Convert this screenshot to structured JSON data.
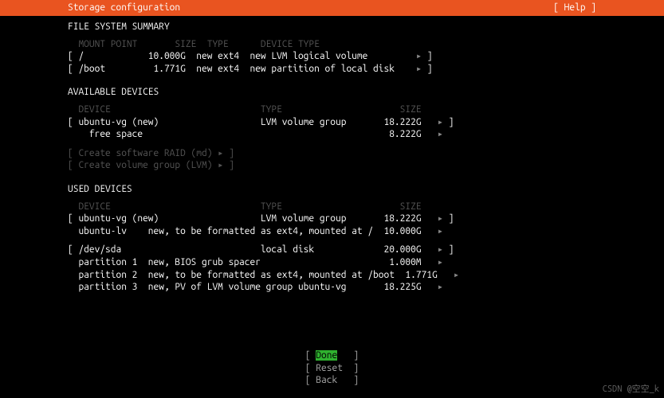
{
  "header": {
    "title": "Storage configuration",
    "help": "[ Help ]"
  },
  "fs_summary": {
    "title": "FILE SYSTEM SUMMARY",
    "cols": {
      "mount": "MOUNT POINT",
      "size": "SIZE",
      "type": "TYPE",
      "dtype": "DEVICE TYPE"
    },
    "rows": [
      {
        "mount": "/",
        "size": "10.000G",
        "type": "new ext4",
        "dtype": "new LVM logical volume"
      },
      {
        "mount": "/boot",
        "size": "1.771G",
        "type": "new ext4",
        "dtype": "new partition of local disk"
      }
    ]
  },
  "available": {
    "title": "AVAILABLE DEVICES",
    "cols": {
      "device": "DEVICE",
      "type": "TYPE",
      "size": "SIZE"
    },
    "rows": [
      {
        "device": "ubuntu-vg (new)",
        "type": "LVM volume group",
        "size": "18.222G",
        "menu": true,
        "bracket": true
      },
      {
        "device": "free space",
        "type": "",
        "size": "8.222G",
        "menu": true,
        "indent": true
      }
    ],
    "actions": [
      "Create software RAID (md) ▸",
      "Create volume group (LVM) ▸"
    ]
  },
  "used": {
    "title": "USED DEVICES",
    "cols": {
      "device": "DEVICE",
      "type": "TYPE",
      "size": "SIZE"
    },
    "groups": [
      {
        "head": {
          "device": "ubuntu-vg (new)",
          "type": "LVM volume group",
          "size": "18.222G"
        },
        "children": [
          {
            "device": "ubuntu-lv",
            "desc": "new, to be formatted as ext4, mounted at /",
            "size": "10.000G"
          }
        ]
      },
      {
        "head": {
          "device": "/dev/sda",
          "type": "local disk",
          "size": "20.000G"
        },
        "children": [
          {
            "device": "partition 1",
            "desc": "new, BIOS grub spacer",
            "size": "1.000M"
          },
          {
            "device": "partition 2",
            "desc": "new, to be formatted as ext4, mounted at /boot",
            "size": "1.771G"
          },
          {
            "device": "partition 3",
            "desc": "new, PV of LVM volume group ubuntu-vg",
            "size": "18.225G"
          }
        ]
      }
    ]
  },
  "buttons": {
    "done": "Done",
    "reset": "Reset",
    "back": "Back"
  },
  "watermark": "CSDN @空空_k"
}
